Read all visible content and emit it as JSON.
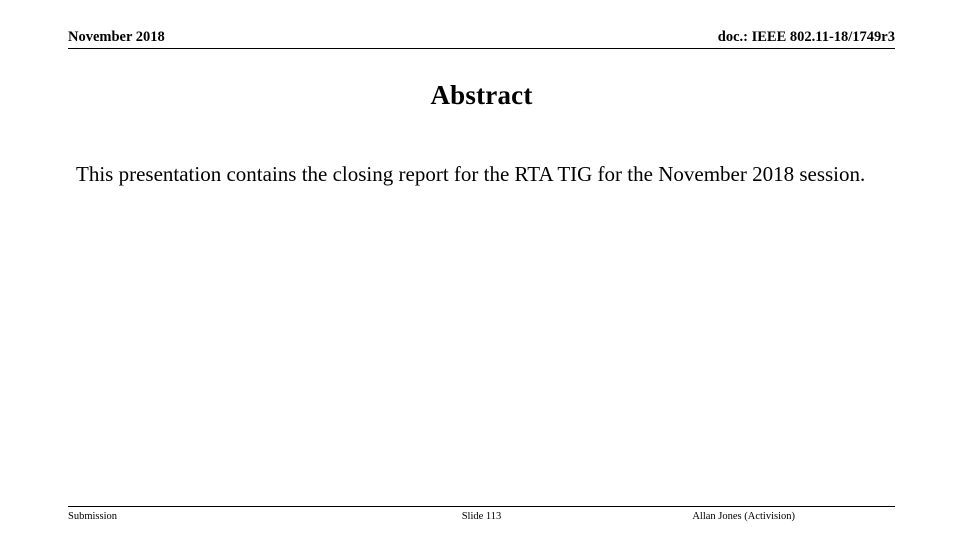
{
  "header": {
    "left_text": "November 2018",
    "right_text": "doc.: IEEE 802.11-18/1749r3"
  },
  "title": "Abstract",
  "body": {
    "paragraph_line_1": "This presentation contains the closing report for the RTA TIG for the",
    "paragraph_line_2": "November 2018 session.",
    "paragraph_full": "This presentation contains the closing report for the RTA TIG for the November 2018 session."
  },
  "footer": {
    "left_text": "Submission",
    "center_text": "Slide 113",
    "right_text": "Allan Jones (Activision)"
  },
  "colors": {
    "background": "#ffffff",
    "text": "#000000",
    "rule": "#000000"
  }
}
